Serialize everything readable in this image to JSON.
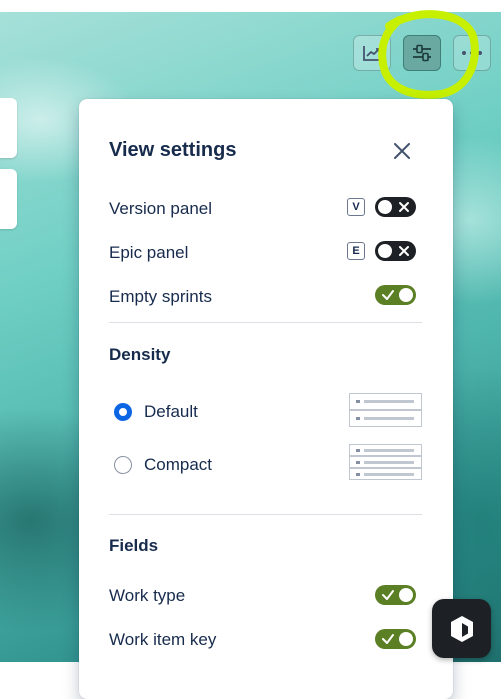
{
  "toolbar": {
    "chart_icon": "chart-line-icon",
    "settings_icon": "view-settings-icon",
    "more_icon": "more-horizontal-icon"
  },
  "panel": {
    "title": "View settings",
    "close_icon": "close-icon",
    "toggles": [
      {
        "label": "Version panel",
        "shortcut": "V",
        "on": false
      },
      {
        "label": "Epic panel",
        "shortcut": "E",
        "on": false
      },
      {
        "label": "Empty sprints",
        "on": true
      }
    ],
    "density": {
      "heading": "Density",
      "options": [
        {
          "label": "Default",
          "selected": true
        },
        {
          "label": "Compact",
          "selected": false
        }
      ]
    },
    "fields": {
      "heading": "Fields",
      "items": [
        {
          "label": "Work type",
          "on": true
        },
        {
          "label": "Work item key",
          "on": true
        }
      ]
    }
  },
  "colors": {
    "toggle_on": "#5b7f24",
    "toggle_off": "#1d2125",
    "radio_selected": "#0c66e4",
    "highlight": "#c6f000"
  }
}
